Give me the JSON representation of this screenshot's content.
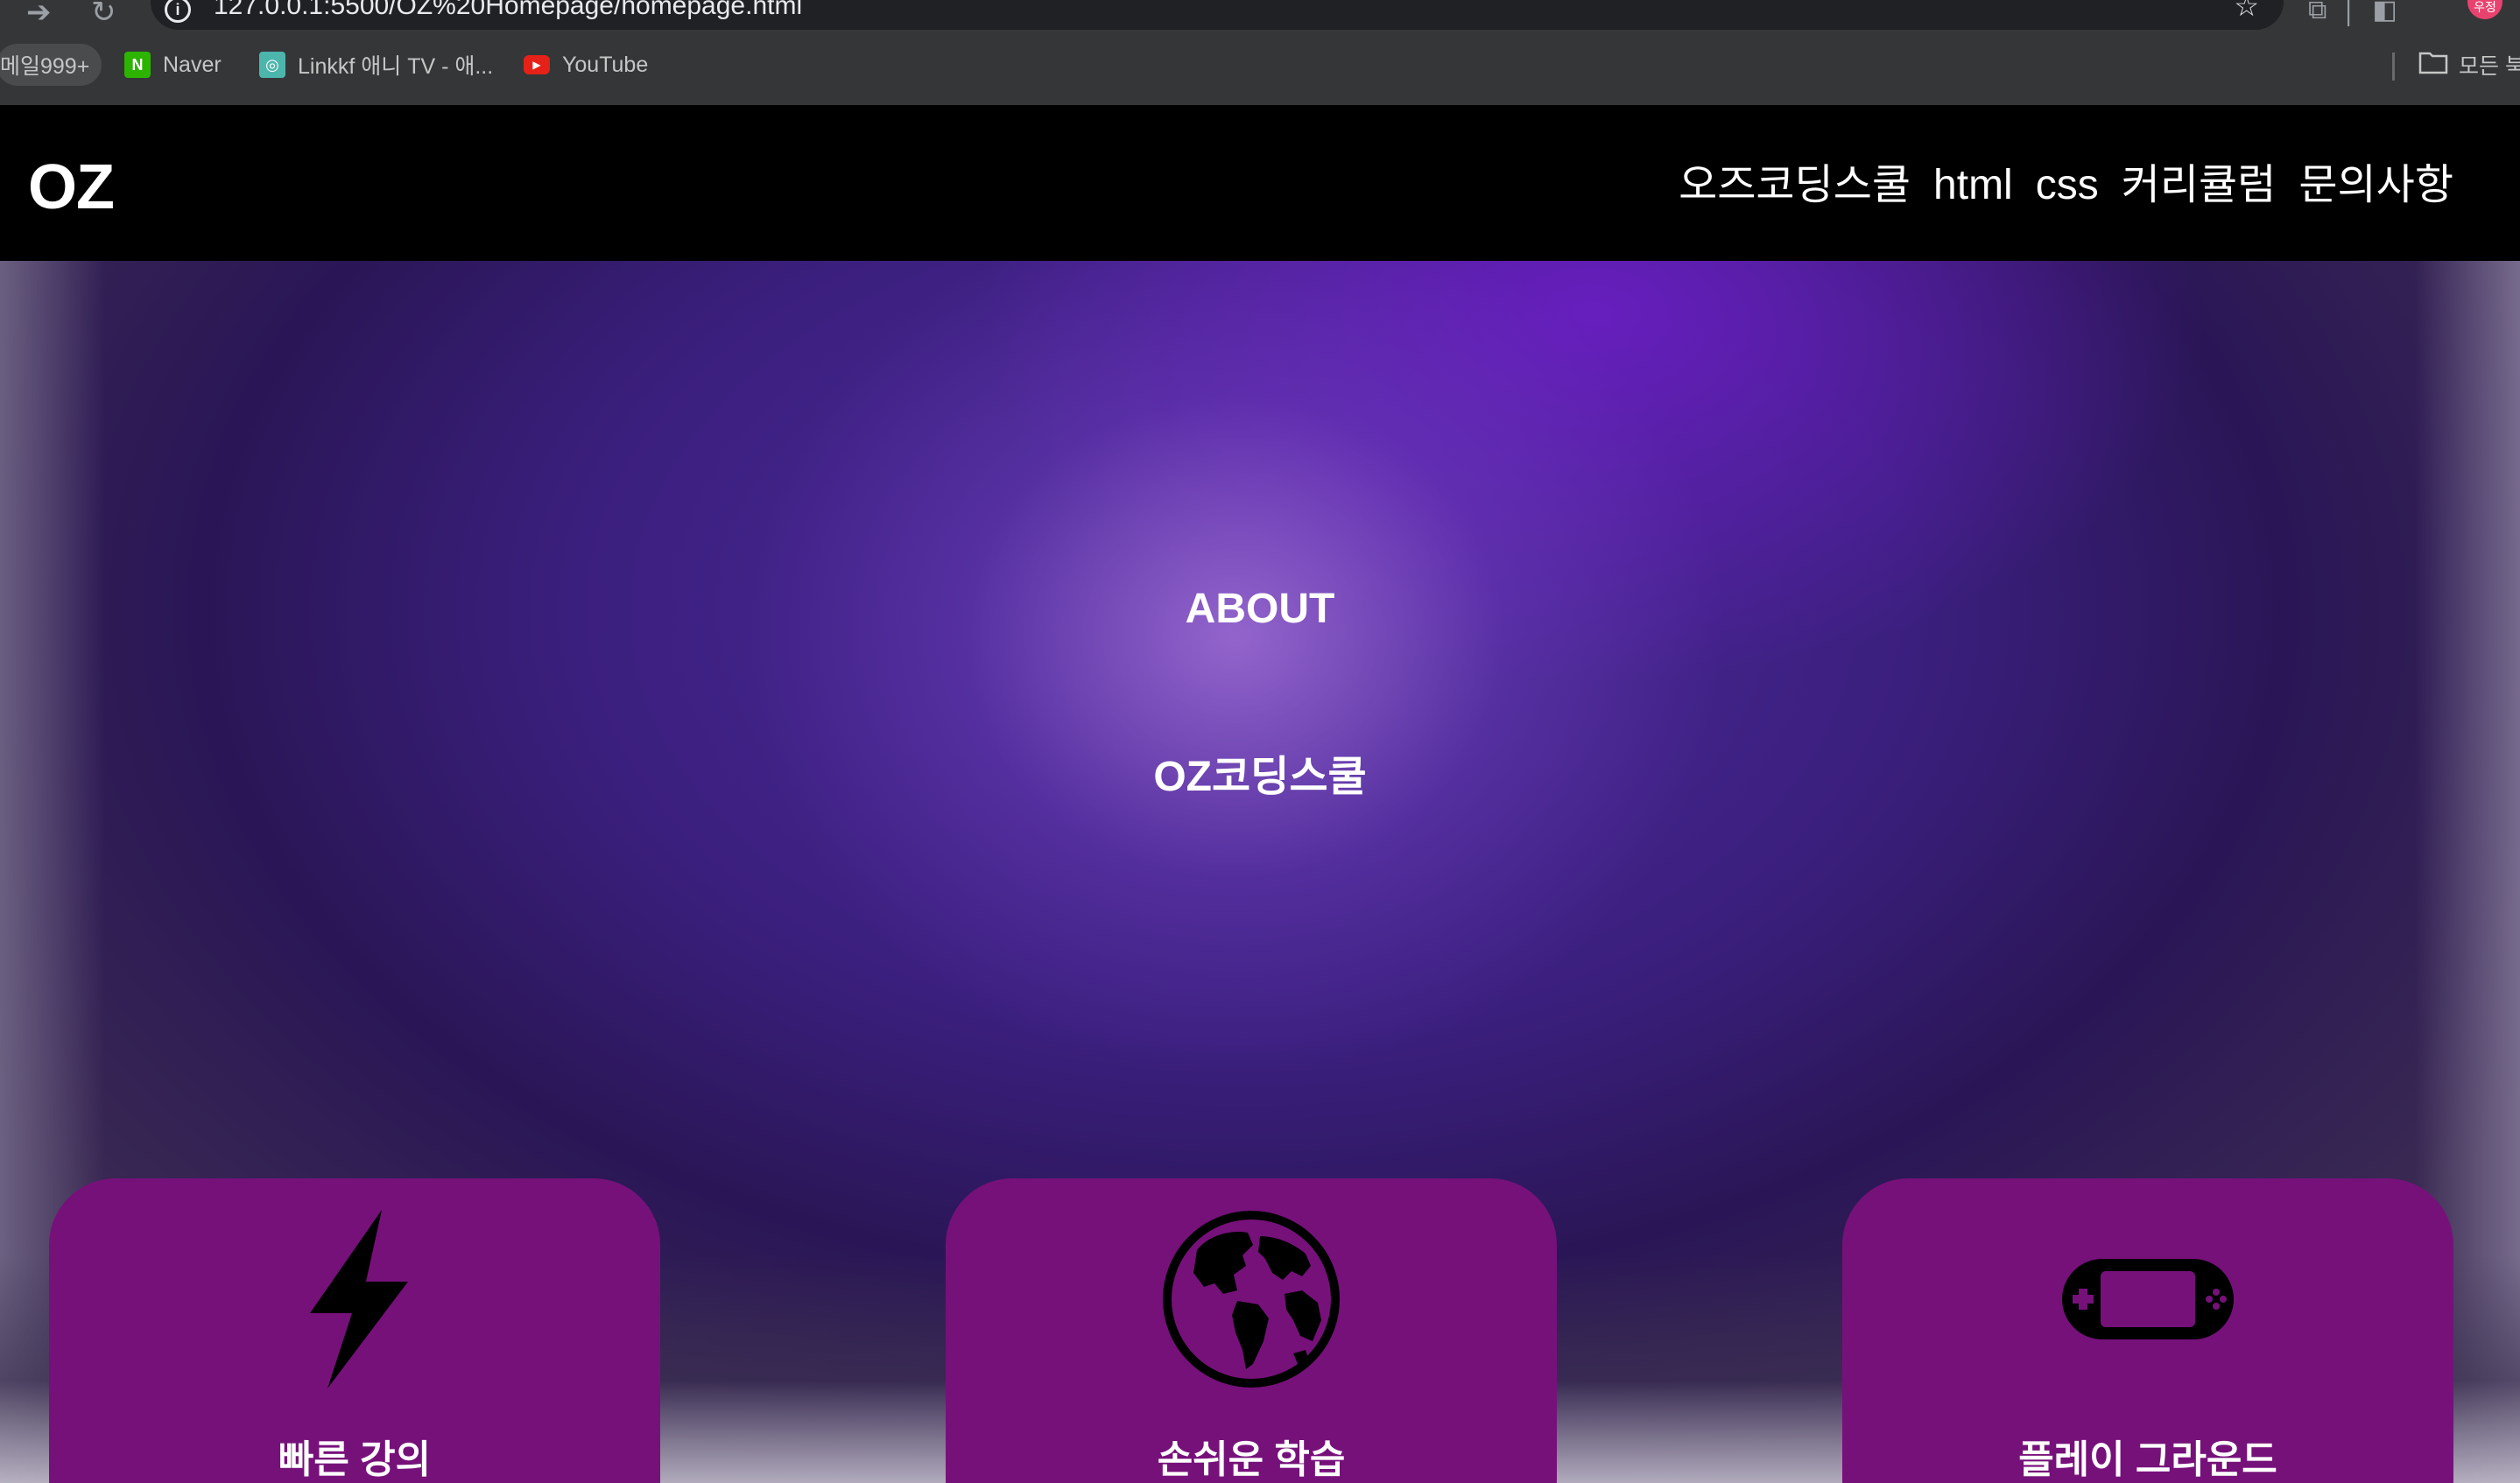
{
  "browser": {
    "url": "127.0.0.1:5500/OZ%20Homepage/homepage.html",
    "profile_badge": "우정",
    "bookmarks": [
      {
        "label": "메일999+"
      },
      {
        "label": "Naver",
        "fav": "N"
      },
      {
        "label": "Linkkf 애니 TV - 애..."
      },
      {
        "label": "YouTube"
      }
    ],
    "all_bookmarks_label": "모든 북"
  },
  "site": {
    "logo": "OZ",
    "nav": [
      "오즈코딩스쿨",
      "html",
      "css",
      "커리큘럼",
      "문의사항"
    ]
  },
  "hero": {
    "title": "ABOUT",
    "subtitle": "OZ코딩스쿨"
  },
  "cards": [
    {
      "label": "빠른 강의",
      "icon": "lightning-icon"
    },
    {
      "label": "손쉬운 학습",
      "icon": "globe-icon"
    },
    {
      "label": "플레이 그라운드",
      "icon": "gamepad-icon"
    }
  ],
  "colors": {
    "header_bg": "#000000",
    "card_bg": "#76117a",
    "hero_purple": "#4e2a9c"
  }
}
